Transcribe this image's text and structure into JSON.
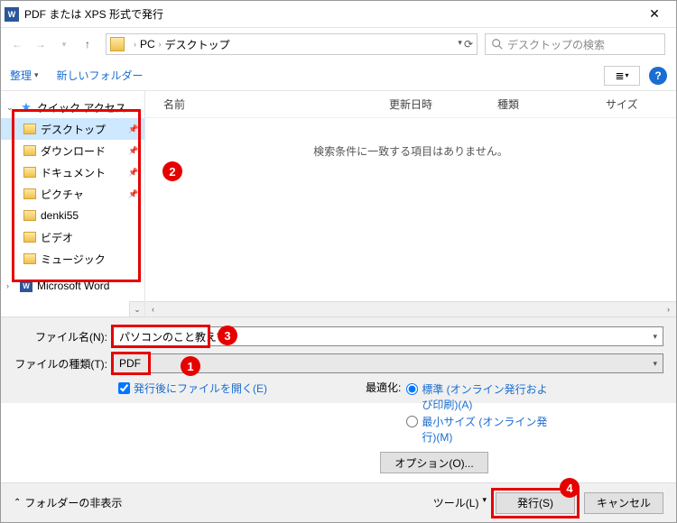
{
  "title": "PDF または XPS 形式で発行",
  "breadcrumb": {
    "pc": "PC",
    "desktop": "デスクトップ"
  },
  "search_placeholder": "デスクトップの検索",
  "toolbar": {
    "organize": "整理",
    "new_folder": "新しいフォルダー"
  },
  "columns": {
    "name": "名前",
    "date": "更新日時",
    "type": "種類",
    "size": "サイズ"
  },
  "empty_message": "検索条件に一致する項目はありません。",
  "tree": {
    "quick_access": "クイック アクセス",
    "items": [
      "デスクトップ",
      "ダウンロード",
      "ドキュメント",
      "ピクチャ",
      "denki55",
      "ビデオ",
      "ミュージック"
    ],
    "word": "Microsoft Word"
  },
  "form": {
    "filename_label": "ファイル名(N):",
    "filename_value": "パソコンのこと教えて",
    "filetype_label": "ファイルの種類(T):",
    "filetype_value": "PDF",
    "open_after": "発行後にファイルを開く(E)"
  },
  "optimize": {
    "label": "最適化:",
    "standard": "標準 (オンライン発行および印刷)(A)",
    "minsize": "最小サイズ (オンライン発行)(M)"
  },
  "options_button": "オプション(O)...",
  "footer": {
    "hide_folders": "フォルダーの非表示",
    "tool": "ツール(L)",
    "publish": "発行(S)",
    "cancel": "キャンセル"
  },
  "callouts": {
    "c1": "1",
    "c2": "2",
    "c3": "3",
    "c4": "4"
  }
}
